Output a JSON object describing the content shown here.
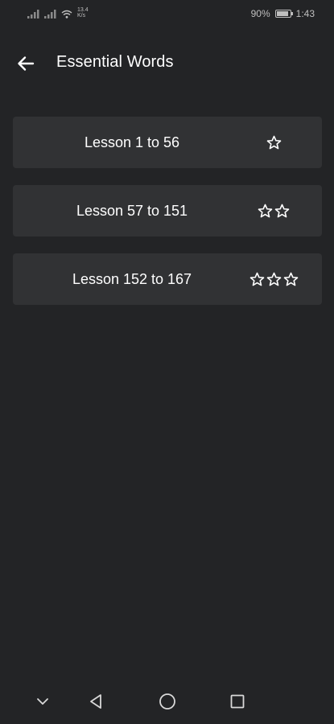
{
  "status_bar": {
    "net_speed_value": "13.4",
    "net_speed_unit": "K/s",
    "battery_percent": "90%",
    "battery_level": 0.9,
    "time": "1:43",
    "icons": [
      "signal-icon",
      "signal-icon",
      "wifi-icon",
      "battery-icon"
    ]
  },
  "app_bar": {
    "title": "Essential Words",
    "back_icon": "arrow-left-icon"
  },
  "lessons": [
    {
      "label": "Lesson 1 to 56",
      "stars": 1
    },
    {
      "label": "Lesson 57 to 151",
      "stars": 2
    },
    {
      "label": "Lesson 152 to 167",
      "stars": 3
    }
  ],
  "nav_bar": {
    "icons": [
      "chevron-down-icon",
      "back-triangle-icon",
      "home-circle-icon",
      "recents-square-icon"
    ]
  },
  "colors": {
    "background": "#232426",
    "card": "#313234",
    "text": "#ffffff",
    "status_text": "#bfbfbf"
  }
}
